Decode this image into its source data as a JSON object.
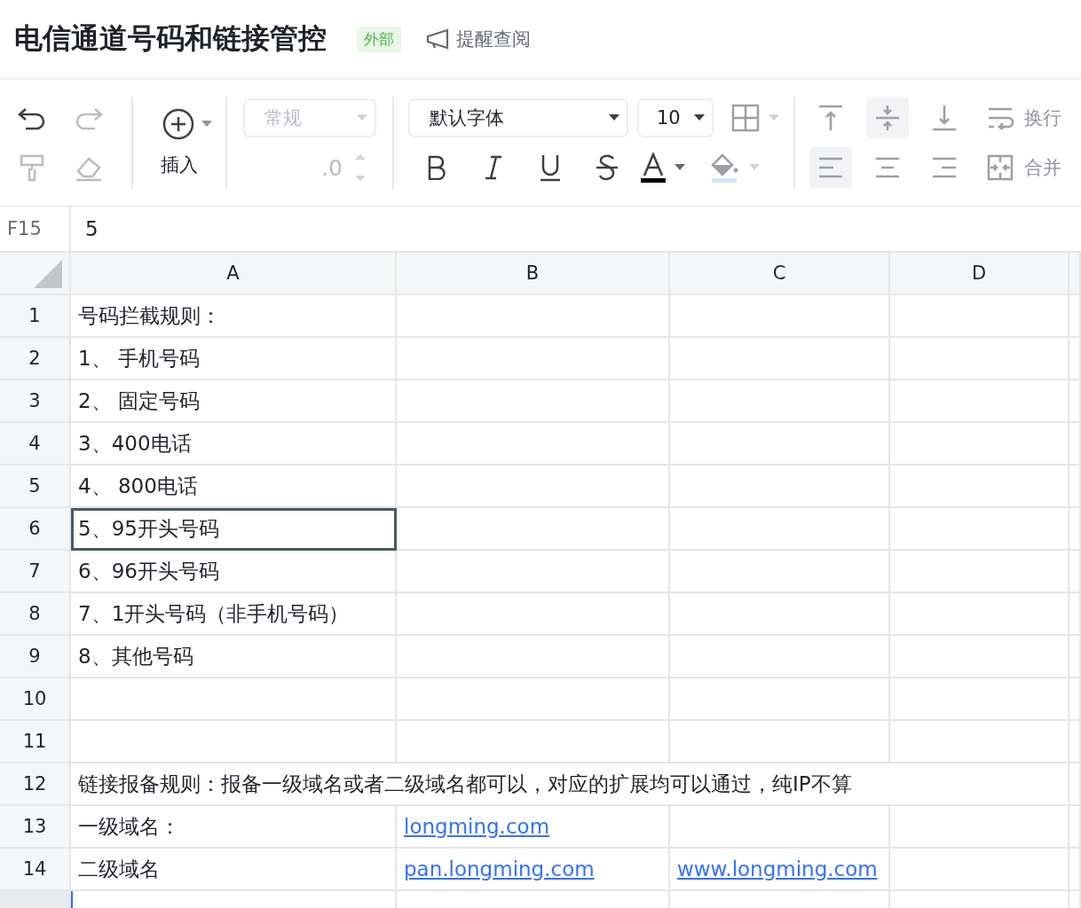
{
  "header": {
    "title": "电信通道号码和链接管控",
    "tag": "外部",
    "remind": "提醒查阅"
  },
  "toolbar": {
    "history": [
      {
        "kind": "undo",
        "disabled": false
      },
      {
        "kind": "redo",
        "disabled": true
      }
    ],
    "tools": [
      {
        "kind": "painter",
        "disabled": true
      },
      {
        "kind": "eraser",
        "disabled": true
      }
    ],
    "insert": "插入",
    "number_format": {
      "value": "常规",
      "disabled": true
    },
    "decimal": {
      "value": ".0",
      "disabled": true
    },
    "font": "默认字体",
    "font_size": "10",
    "vertical_align": [
      {
        "kind": "top",
        "selected": false
      },
      {
        "kind": "middle",
        "selected": true
      },
      {
        "kind": "bottom",
        "selected": false
      }
    ],
    "horizontal_align": [
      {
        "kind": "left",
        "selected": true
      },
      {
        "kind": "center",
        "selected": false
      },
      {
        "kind": "right",
        "selected": false
      }
    ],
    "wrap": "换行",
    "merge": "合并"
  },
  "formula_bar": {
    "cell": "F15",
    "value": "5"
  },
  "columns": [
    "A",
    "B",
    "C",
    "D"
  ],
  "rows": [
    {
      "number": "1",
      "cells": {
        "A": {
          "text": "号码拦截规则：",
          "link": false,
          "selected": false
        }
      }
    },
    {
      "number": "2",
      "cells": {
        "A": {
          "text": "1、 手机号码",
          "link": false,
          "selected": false
        }
      }
    },
    {
      "number": "3",
      "cells": {
        "A": {
          "text": "2、 固定号码",
          "link": false,
          "selected": false
        }
      }
    },
    {
      "number": "4",
      "cells": {
        "A": {
          "text": "3、400电话",
          "link": false,
          "selected": false
        }
      }
    },
    {
      "number": "5",
      "cells": {
        "A": {
          "text": "4、 800电话",
          "link": false,
          "selected": false
        }
      }
    },
    {
      "number": "6",
      "cells": {
        "A": {
          "text": "5、95开头号码",
          "link": false,
          "selected": true
        }
      }
    },
    {
      "number": "7",
      "cells": {
        "A": {
          "text": "6、96开头号码",
          "link": false,
          "selected": false
        }
      }
    },
    {
      "number": "8",
      "cells": {
        "A": {
          "text": "7、1开头号码（非手机号码）",
          "link": false,
          "selected": false
        }
      }
    },
    {
      "number": "9",
      "cells": {
        "A": {
          "text": "8、其他号码",
          "link": false,
          "selected": false
        }
      }
    },
    {
      "number": "10"
    },
    {
      "number": "11"
    },
    {
      "number": "12",
      "cells": {
        "A": {
          "text": "链接报备规则：报备一级域名或者二级域名都可以，对应的扩展均可以通过，纯IP不算",
          "link": false,
          "selected": false,
          "overflow": true
        }
      }
    },
    {
      "number": "13",
      "cells": {
        "A": {
          "text": "一级域名：",
          "link": false,
          "selected": false
        },
        "B": {
          "text": "longming.com",
          "link": true,
          "selected": false
        }
      }
    },
    {
      "number": "14",
      "cells": {
        "A": {
          "text": "二级域名",
          "link": false,
          "selected": false
        },
        "B": {
          "text": "pan.longming.com",
          "link": true,
          "selected": false
        },
        "C": {
          "text": "www.longming.com",
          "link": true,
          "selected": false
        }
      }
    }
  ]
}
